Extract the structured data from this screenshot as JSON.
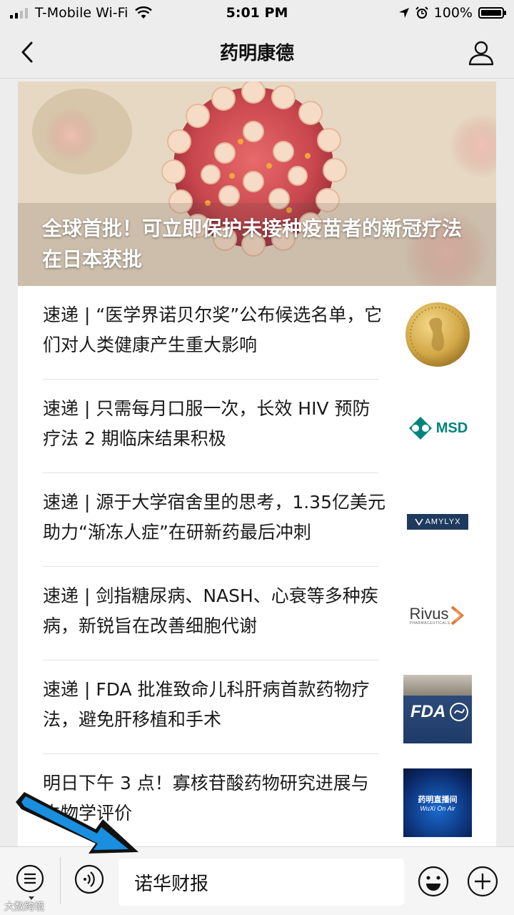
{
  "status_bar": {
    "carrier": "T-Mobile Wi-Fi",
    "time": "5:01 PM",
    "battery_percent": "100%",
    "battery_level": 1.0
  },
  "nav": {
    "title": "药明康德",
    "back_icon": "chevron-left-icon",
    "profile_icon": "person-icon"
  },
  "hero": {
    "title": "全球首批！可立即保护未接种疫苗者的新冠疗法在日本获批"
  },
  "articles": [
    {
      "title": "速递 | “医学界诺贝尔奖”公布候选名单，它们对人类健康产生重大影响",
      "thumb": "gold-medal"
    },
    {
      "title": "速递 | 只需每月口服一次，长效 HIV 预防疗法 2 期临床结果积极",
      "thumb": "msd-logo",
      "thumb_text": "MSD"
    },
    {
      "title": "速递 | 源于大学宿舍里的思考，1.35亿美元助力“渐冻人症”在研新药最后冲刺",
      "thumb": "amylyx-logo",
      "thumb_text": "AMYLYX"
    },
    {
      "title": "速递 | 剑指糖尿病、NASH、心衰等多种疾病，新锐旨在改善细胞代谢",
      "thumb": "rivus-logo",
      "thumb_text": "Rivus",
      "thumb_subtext": "PHARMACEUTICALS"
    },
    {
      "title": "速递 | FDA 批准致命儿科肝病首款药物疗法，避免肝移植和手术",
      "thumb": "fda-photo",
      "thumb_text": "FDA"
    },
    {
      "title": "明日下午 3 点！寡核苷酸药物研究进展与生物学评价",
      "thumb": "wuxi-on-air",
      "thumb_text": "药明直播间",
      "thumb_subtext": "WuXi On Air"
    }
  ],
  "bottom_bar": {
    "input_text": "诺华财报",
    "menu_icon": "list-menu-icon",
    "voice_icon": "voice-icon",
    "emoji_icon": "smiley-icon",
    "plus_icon": "plus-circle-icon"
  },
  "watermark": "大数跨境",
  "colors": {
    "accent_blue": "#1a8fe0",
    "msd_teal": "#00857c",
    "background": "#ededed"
  }
}
